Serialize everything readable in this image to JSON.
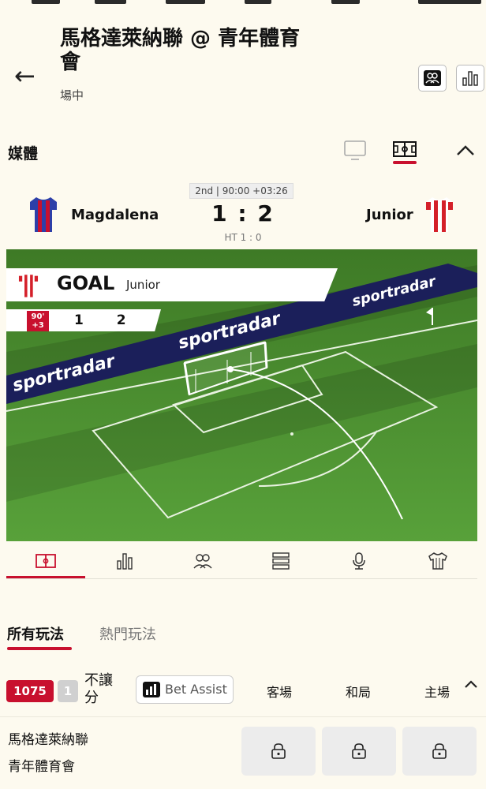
{
  "header": {
    "title": "馬格達萊納聯 @ 青年體育會",
    "subtitle": "場中"
  },
  "media": {
    "label": "媒體"
  },
  "match": {
    "period": "2nd | 90:00 +03:26",
    "home_team": "Magdalena",
    "away_team": "Junior",
    "score": "1 : 2",
    "halftime": "HT 1 : 0"
  },
  "pitch": {
    "goal_label": "GOAL",
    "goal_team": "Junior",
    "minute_top": "90'",
    "minute_bottom": "+3",
    "banner_score_home": "1",
    "banner_score_away": "2",
    "ad_text": "sportradar"
  },
  "market_tabs": {
    "all": "所有玩法",
    "popular": "熱門玩法"
  },
  "market": {
    "count": "1075",
    "live_count": "1",
    "name": "不讓分",
    "bet_assist": "Bet Assist",
    "col_away": "客場",
    "col_draw": "和局",
    "col_home": "主場"
  },
  "row": {
    "team1": "馬格達萊納聯",
    "team2": "青年體育會"
  },
  "colors": {
    "accent": "#c8102e",
    "pitch": "#4a8a2e",
    "background": "#fdfaef"
  }
}
